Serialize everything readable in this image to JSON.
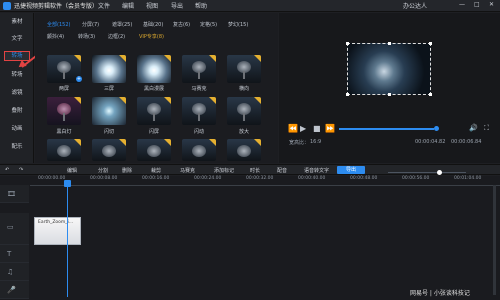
{
  "titlebar": {
    "app_title": "迅捷视频剪辑软件（会员专版）",
    "menus": [
      "文件",
      "编辑",
      "视图",
      "导出",
      "帮助"
    ],
    "user": "办公达人",
    "window_controls": [
      "—",
      "□",
      "✕"
    ]
  },
  "sidebar": {
    "items": [
      "素材",
      "文字",
      "转场",
      "转场",
      "滤镜",
      "叠附",
      "动画",
      "配乐"
    ]
  },
  "panel": {
    "tabs": [
      "全部(152)",
      "分屏(7)",
      "遮罩(25)",
      "基础(20)",
      "复古(6)",
      "定格(5)",
      "梦幻(15)",
      "颤抖(4)",
      "转场(3)",
      "边框(2)",
      "VIP专享(8)"
    ],
    "thumbs": [
      {
        "label": "两屏",
        "tag": "corner"
      },
      {
        "label": "三屏",
        "tag": "corner"
      },
      {
        "label": "黑白漫展",
        "tag": "corner"
      },
      {
        "label": "马赛克",
        "tag": "corner"
      },
      {
        "label": "横向",
        "tag": "corner"
      },
      {
        "label": "黑白灯",
        "tag": "corner"
      },
      {
        "label": "闪切",
        "tag": "corner"
      },
      {
        "label": "闪屏",
        "tag": "corner"
      },
      {
        "label": "闪动",
        "tag": "corner"
      },
      {
        "label": "放大",
        "tag": "corner"
      },
      {
        "label": "",
        "tag": "corner"
      },
      {
        "label": "",
        "tag": "corner"
      },
      {
        "label": "",
        "tag": "corner"
      },
      {
        "label": "",
        "tag": "corner"
      },
      {
        "label": "",
        "tag": "corner"
      }
    ]
  },
  "preview": {
    "time_current": "00:00:04.82",
    "time_total": "00:00:06.84",
    "ratio_label": "宽高比：",
    "ratio": "16:9"
  },
  "toolbar": {
    "tools": [
      "↶",
      "↷",
      "编辑",
      "分割",
      "删除",
      "裁剪",
      "马赛克",
      "添加标记",
      "时长",
      "配音",
      "语音转文字"
    ],
    "export": "导出"
  },
  "timeline": {
    "ticks": [
      "00:00:00.00",
      "00:00:08.00",
      "00:00:16.00",
      "00:00:24.00",
      "00:00:32.00",
      "00:00:40.00",
      "00:00:48.00",
      "00:00:56.00",
      "00:01:04.00"
    ],
    "clip_label": "Earth_Zoom_i..."
  },
  "watermark": "网易号 | 小张谈科技记"
}
